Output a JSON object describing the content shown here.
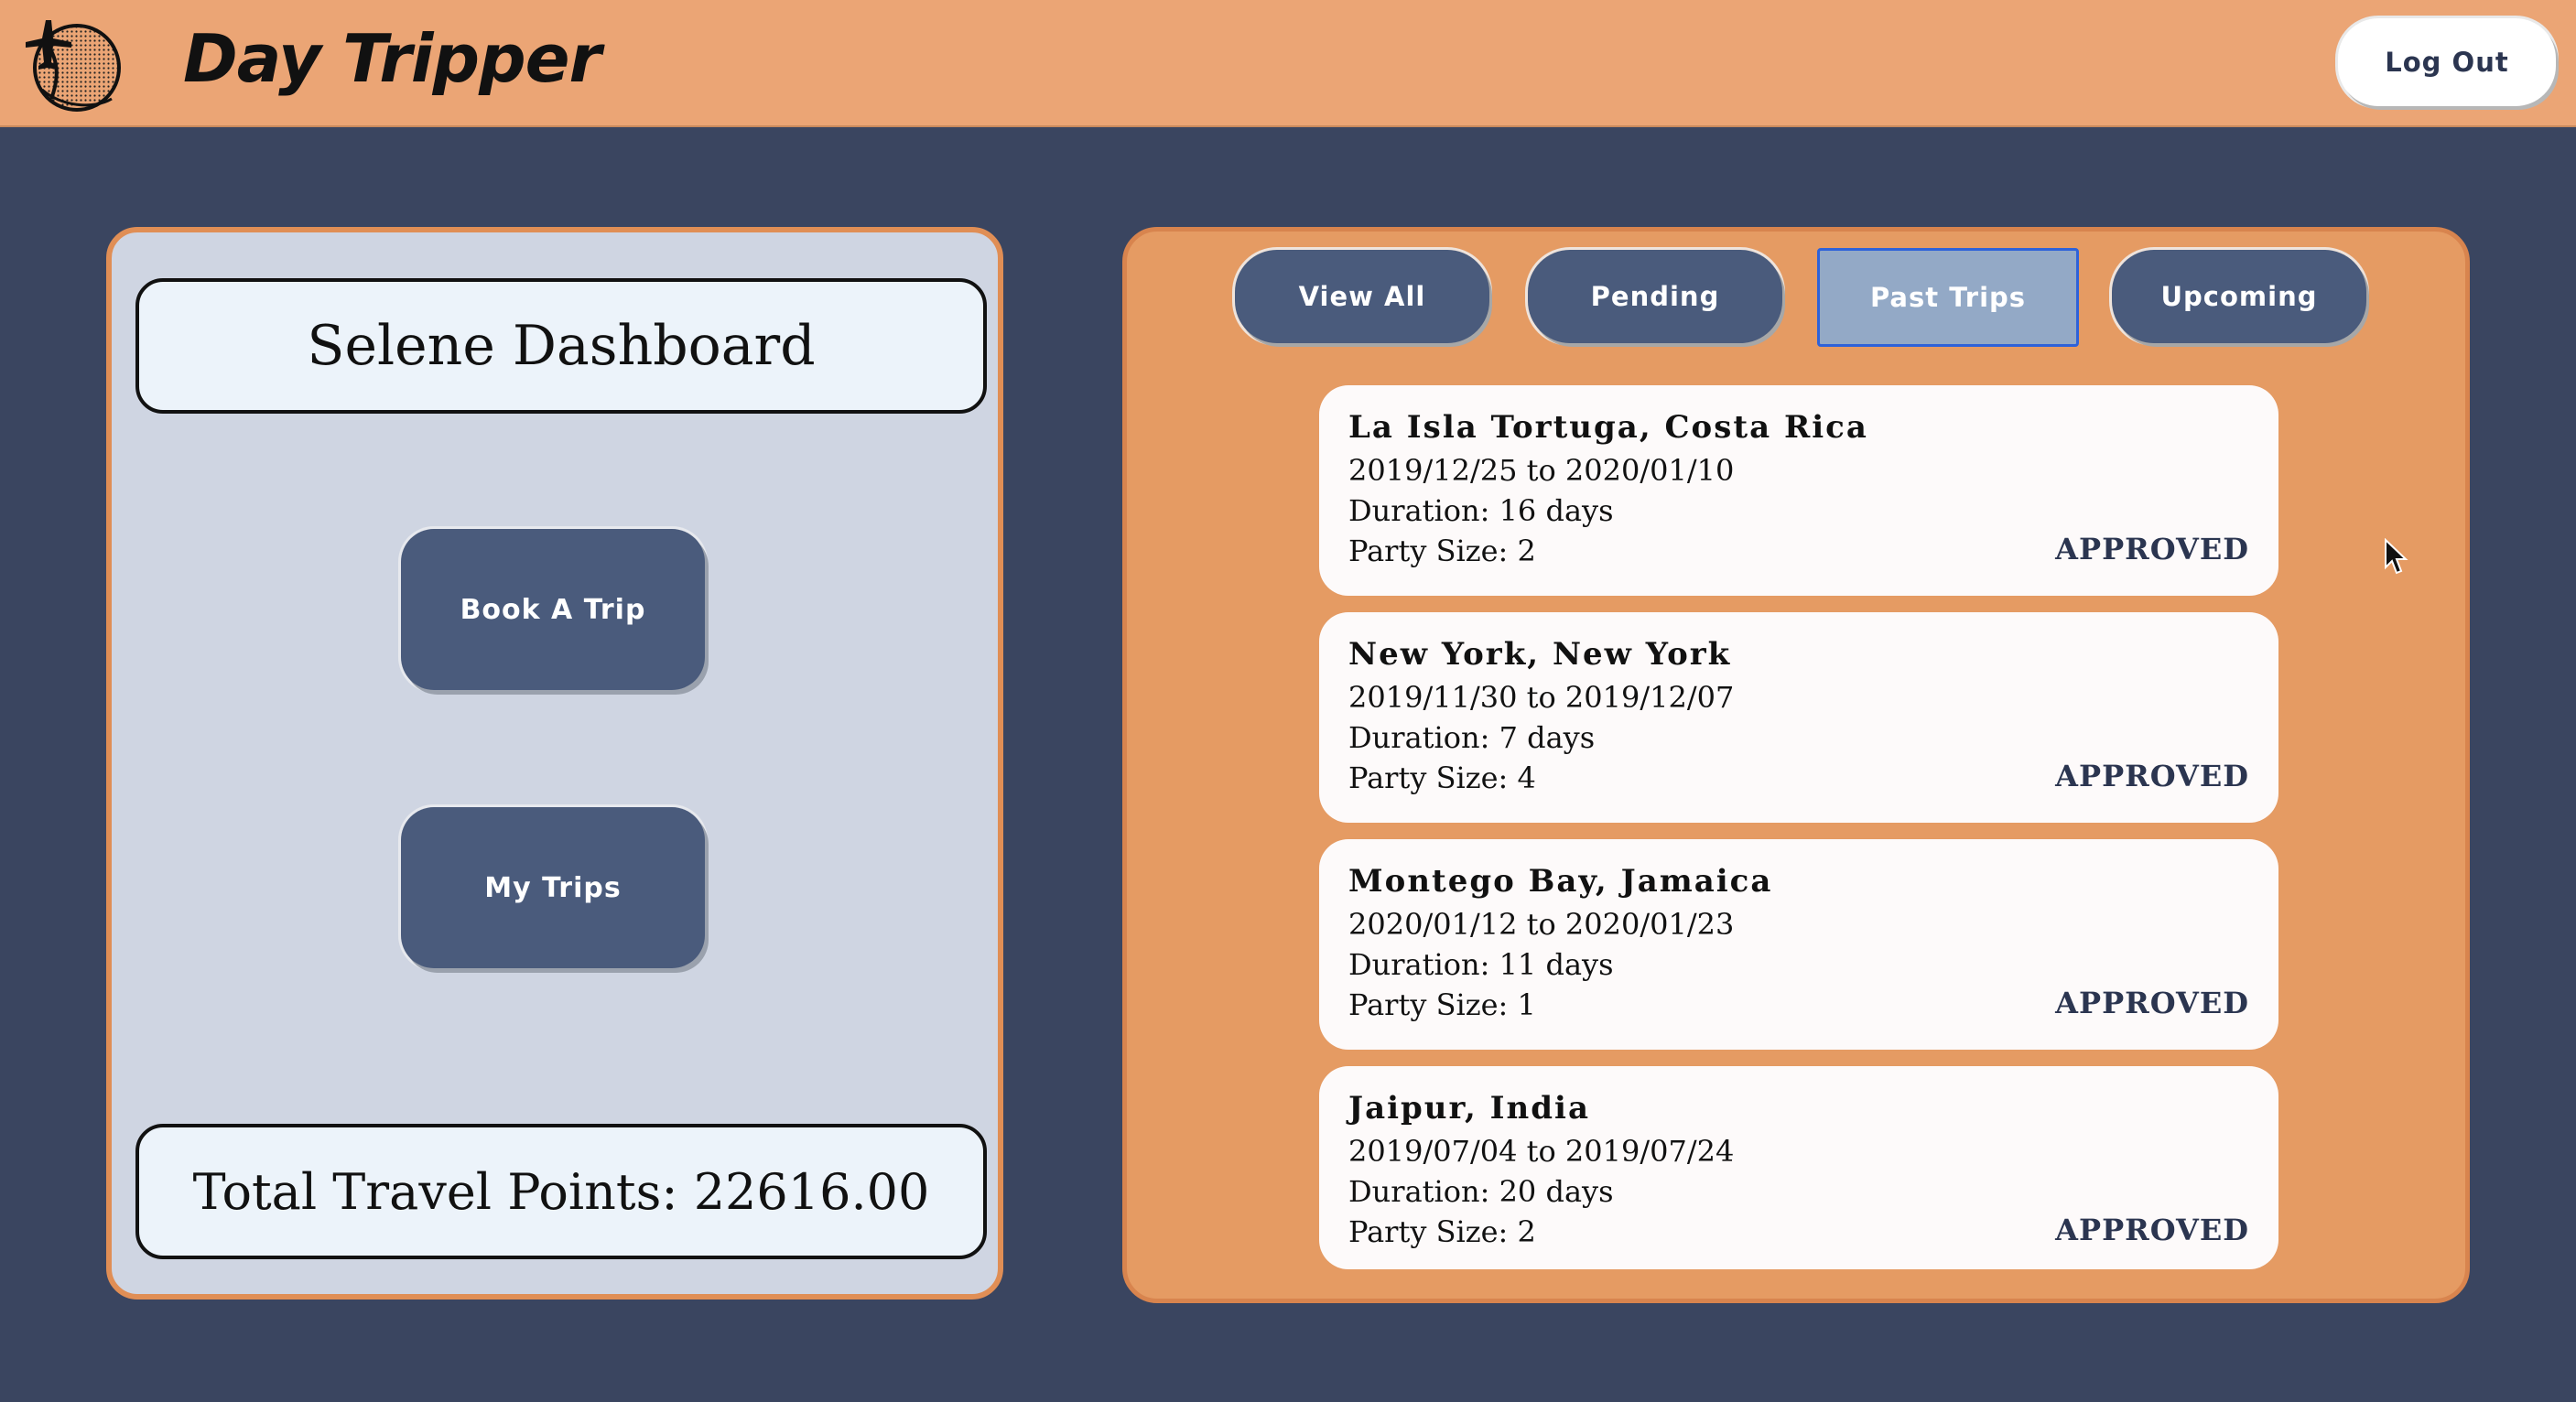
{
  "header": {
    "app_title": "Day Tripper",
    "logout_label": "Log Out",
    "logo_icon": "globe-plane-icon",
    "background": "#eba575"
  },
  "dashboard": {
    "title": "Selene Dashboard",
    "book_trip_label": "Book A Trip",
    "my_trips_label": "My Trips",
    "points_text": "Total Travel Points: 22616.00"
  },
  "filters": {
    "tabs": [
      {
        "label": "View All",
        "active": false
      },
      {
        "label": "Pending",
        "active": false
      },
      {
        "label": "Past Trips",
        "active": true
      },
      {
        "label": "Upcoming",
        "active": false
      }
    ]
  },
  "trips": [
    {
      "destination": "La Isla Tortuga, Costa Rica",
      "dates": "2019/12/25 to 2020/01/10",
      "duration": "Duration: 16 days",
      "party": "Party Size: 2",
      "status": "APPROVED"
    },
    {
      "destination": "New York, New York",
      "dates": "2019/11/30 to 2019/12/07",
      "duration": "Duration: 7 days",
      "party": "Party Size: 4",
      "status": "APPROVED"
    },
    {
      "destination": "Montego Bay, Jamaica",
      "dates": "2020/01/12 to 2020/01/23",
      "duration": "Duration: 11 days",
      "party": "Party Size: 1",
      "status": "APPROVED"
    },
    {
      "destination": "Jaipur, India",
      "dates": "2019/07/04 to 2019/07/24",
      "duration": "Duration: 20 days",
      "party": "Party Size: 2",
      "status": "APPROVED"
    }
  ],
  "colors": {
    "page_background": "#3a4560",
    "accent_orange": "#e59b63",
    "button_navy": "#4a5b7c",
    "active_tab": "#93a9c6",
    "left_panel": "#cfd5e2"
  }
}
